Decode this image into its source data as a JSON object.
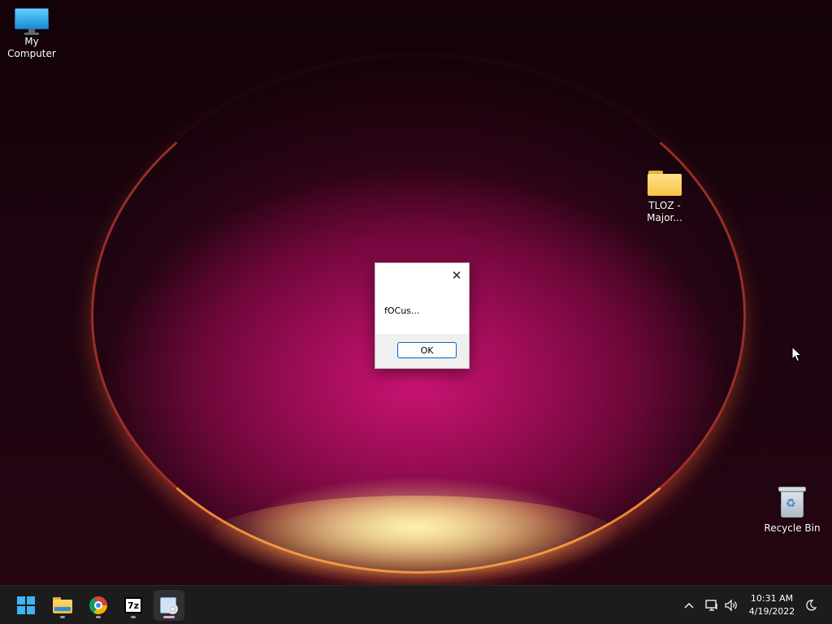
{
  "desktop": {
    "icons": [
      {
        "label": "My Computer",
        "icon": "computer-icon"
      },
      {
        "label": "TLOZ -\nMajor...",
        "icon": "folder-icon"
      },
      {
        "label": "Recycle Bin",
        "icon": "recycle-bin-icon"
      }
    ]
  },
  "dialog": {
    "message": "fOCus...",
    "ok_label": "OK",
    "close_glyph": "✕"
  },
  "taskbar": {
    "apps": [
      {
        "name": "Start",
        "icon": "windows-start-icon"
      },
      {
        "name": "File Explorer",
        "icon": "file-explorer-icon"
      },
      {
        "name": "Google Chrome",
        "icon": "chrome-icon"
      },
      {
        "name": "7-Zip",
        "icon": "7zip-icon",
        "glyph": "7z"
      },
      {
        "name": "Active application",
        "icon": "app-disc-icon"
      }
    ],
    "tray": {
      "chevron": "^",
      "time": "10:31 AM",
      "date": "4/19/2022"
    }
  },
  "colors": {
    "accent": "#0067c0",
    "taskbar_bg": "#1c1c1c",
    "start_blue": "#3fb4f5"
  }
}
